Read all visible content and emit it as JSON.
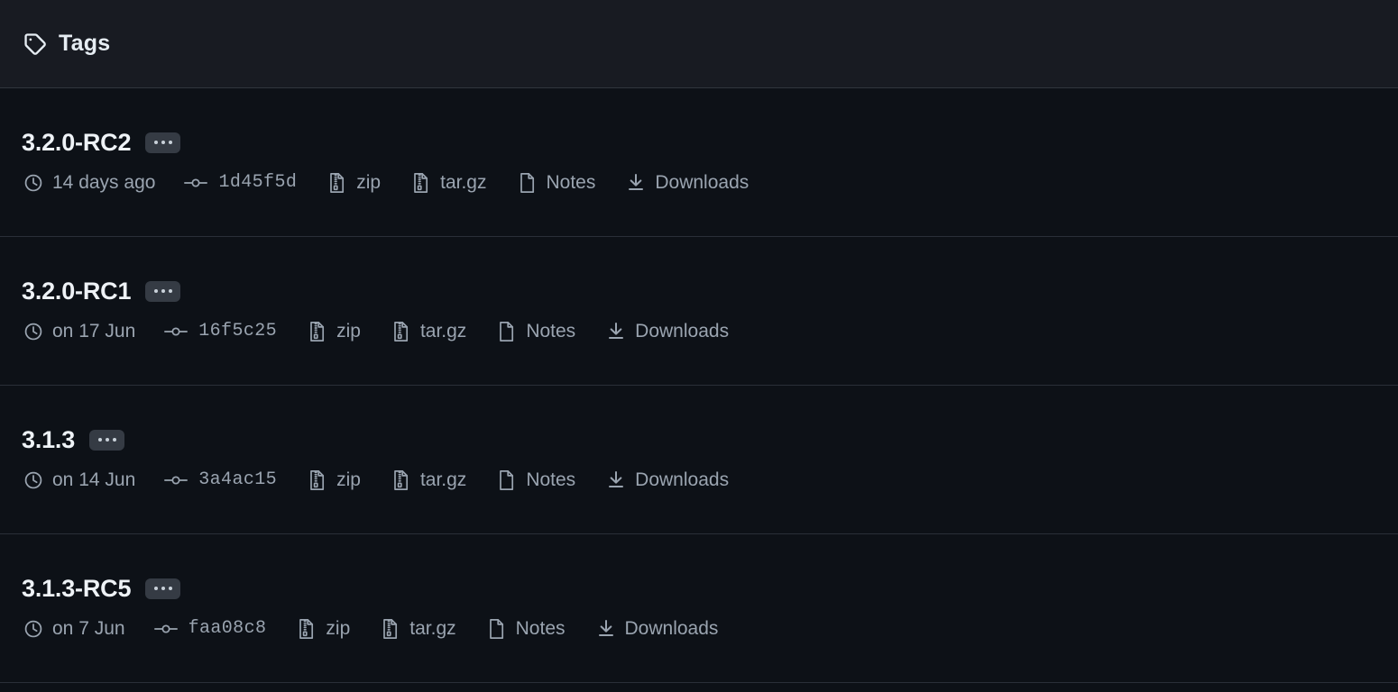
{
  "header": {
    "icon": "tag-icon",
    "title": "Tags"
  },
  "labels": {
    "zip": "zip",
    "targz": "tar.gz",
    "notes": "Notes",
    "downloads": "Downloads",
    "kebab": "..."
  },
  "icons": {
    "clock": "clock-icon",
    "commit": "git-commit-icon",
    "zip": "file-zip-icon",
    "notes": "file-icon",
    "downloads": "download-icon"
  },
  "colors": {
    "page_background": "#0d1117",
    "header_background": "#181b22",
    "divider": "#2a2f38",
    "title_text": "#eef2f6",
    "meta_text": "#9aa4b0",
    "badge_background": "#353b44"
  },
  "tags": [
    {
      "name": "3.2.0-RC2",
      "date": "14 days ago",
      "commit": "1d45f5d",
      "zip": "zip",
      "targz": "tar.gz",
      "notes": "Notes",
      "downloads": "Downloads"
    },
    {
      "name": "3.2.0-RC1",
      "date": "on 17 Jun",
      "commit": "16f5c25",
      "zip": "zip",
      "targz": "tar.gz",
      "notes": "Notes",
      "downloads": "Downloads"
    },
    {
      "name": "3.1.3",
      "date": "on 14 Jun",
      "commit": "3a4ac15",
      "zip": "zip",
      "targz": "tar.gz",
      "notes": "Notes",
      "downloads": "Downloads"
    },
    {
      "name": "3.1.3-RC5",
      "date": "on 7 Jun",
      "commit": "faa08c8",
      "zip": "zip",
      "targz": "tar.gz",
      "notes": "Notes",
      "downloads": "Downloads"
    }
  ]
}
